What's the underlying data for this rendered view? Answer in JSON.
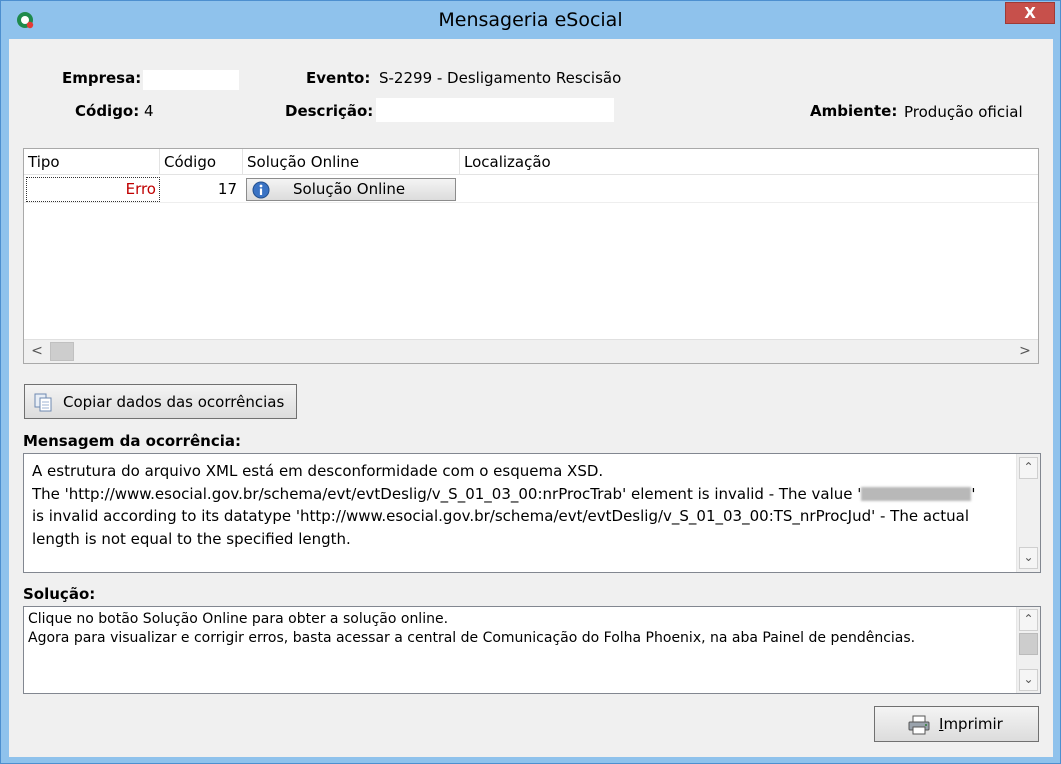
{
  "window": {
    "title": "Mensageria eSocial",
    "close_label": "X"
  },
  "header": {
    "empresa_label": "Empresa:",
    "empresa_value": "",
    "evento_label": "Evento:",
    "evento_value": "S-2299 - Desligamento Rescisão",
    "codigo_label": "Código:",
    "codigo_value": "4",
    "descricao_label": "Descrição:",
    "descricao_value": "",
    "ambiente_label": "Ambiente:",
    "ambiente_value": "Produção oficial"
  },
  "grid": {
    "columns": [
      "Tipo",
      "Código",
      "Solução Online",
      "Localização"
    ],
    "rows": [
      {
        "tipo": "Erro",
        "codigo": "17",
        "solucao": "Solução Online",
        "localizacao": ""
      }
    ]
  },
  "copy_button": {
    "label": "Copiar dados das ocorrências"
  },
  "mensagem": {
    "label": "Mensagem da ocorrência:",
    "lines": [
      "A estrutura do arquivo XML está em desconformidade com o esquema XSD.",
      "The 'http://www.esocial.gov.br/schema/evt/evtDeslig/v_S_01_03_00:nrProcTrab' element is invalid - The value '",
      "is invalid according to its datatype 'http://www.esocial.gov.br/schema/evt/evtDeslig/v_S_01_03_00:TS_nrProcJud' - The actual",
      "length is not equal to the specified length."
    ],
    "line2_tail": "'"
  },
  "solucao": {
    "label": "Solução:",
    "lines": [
      "Clique no botão Solução Online para obter a solução online.",
      "Agora para visualizar e corrigir erros, basta acessar a central de Comunicação do Folha Phoenix, na aba Painel de pendências."
    ]
  },
  "print_button": {
    "label": "Imprimir"
  },
  "colors": {
    "titlebar": "#8fc2ec",
    "close": "#c7504b",
    "error_text": "#c00000"
  }
}
